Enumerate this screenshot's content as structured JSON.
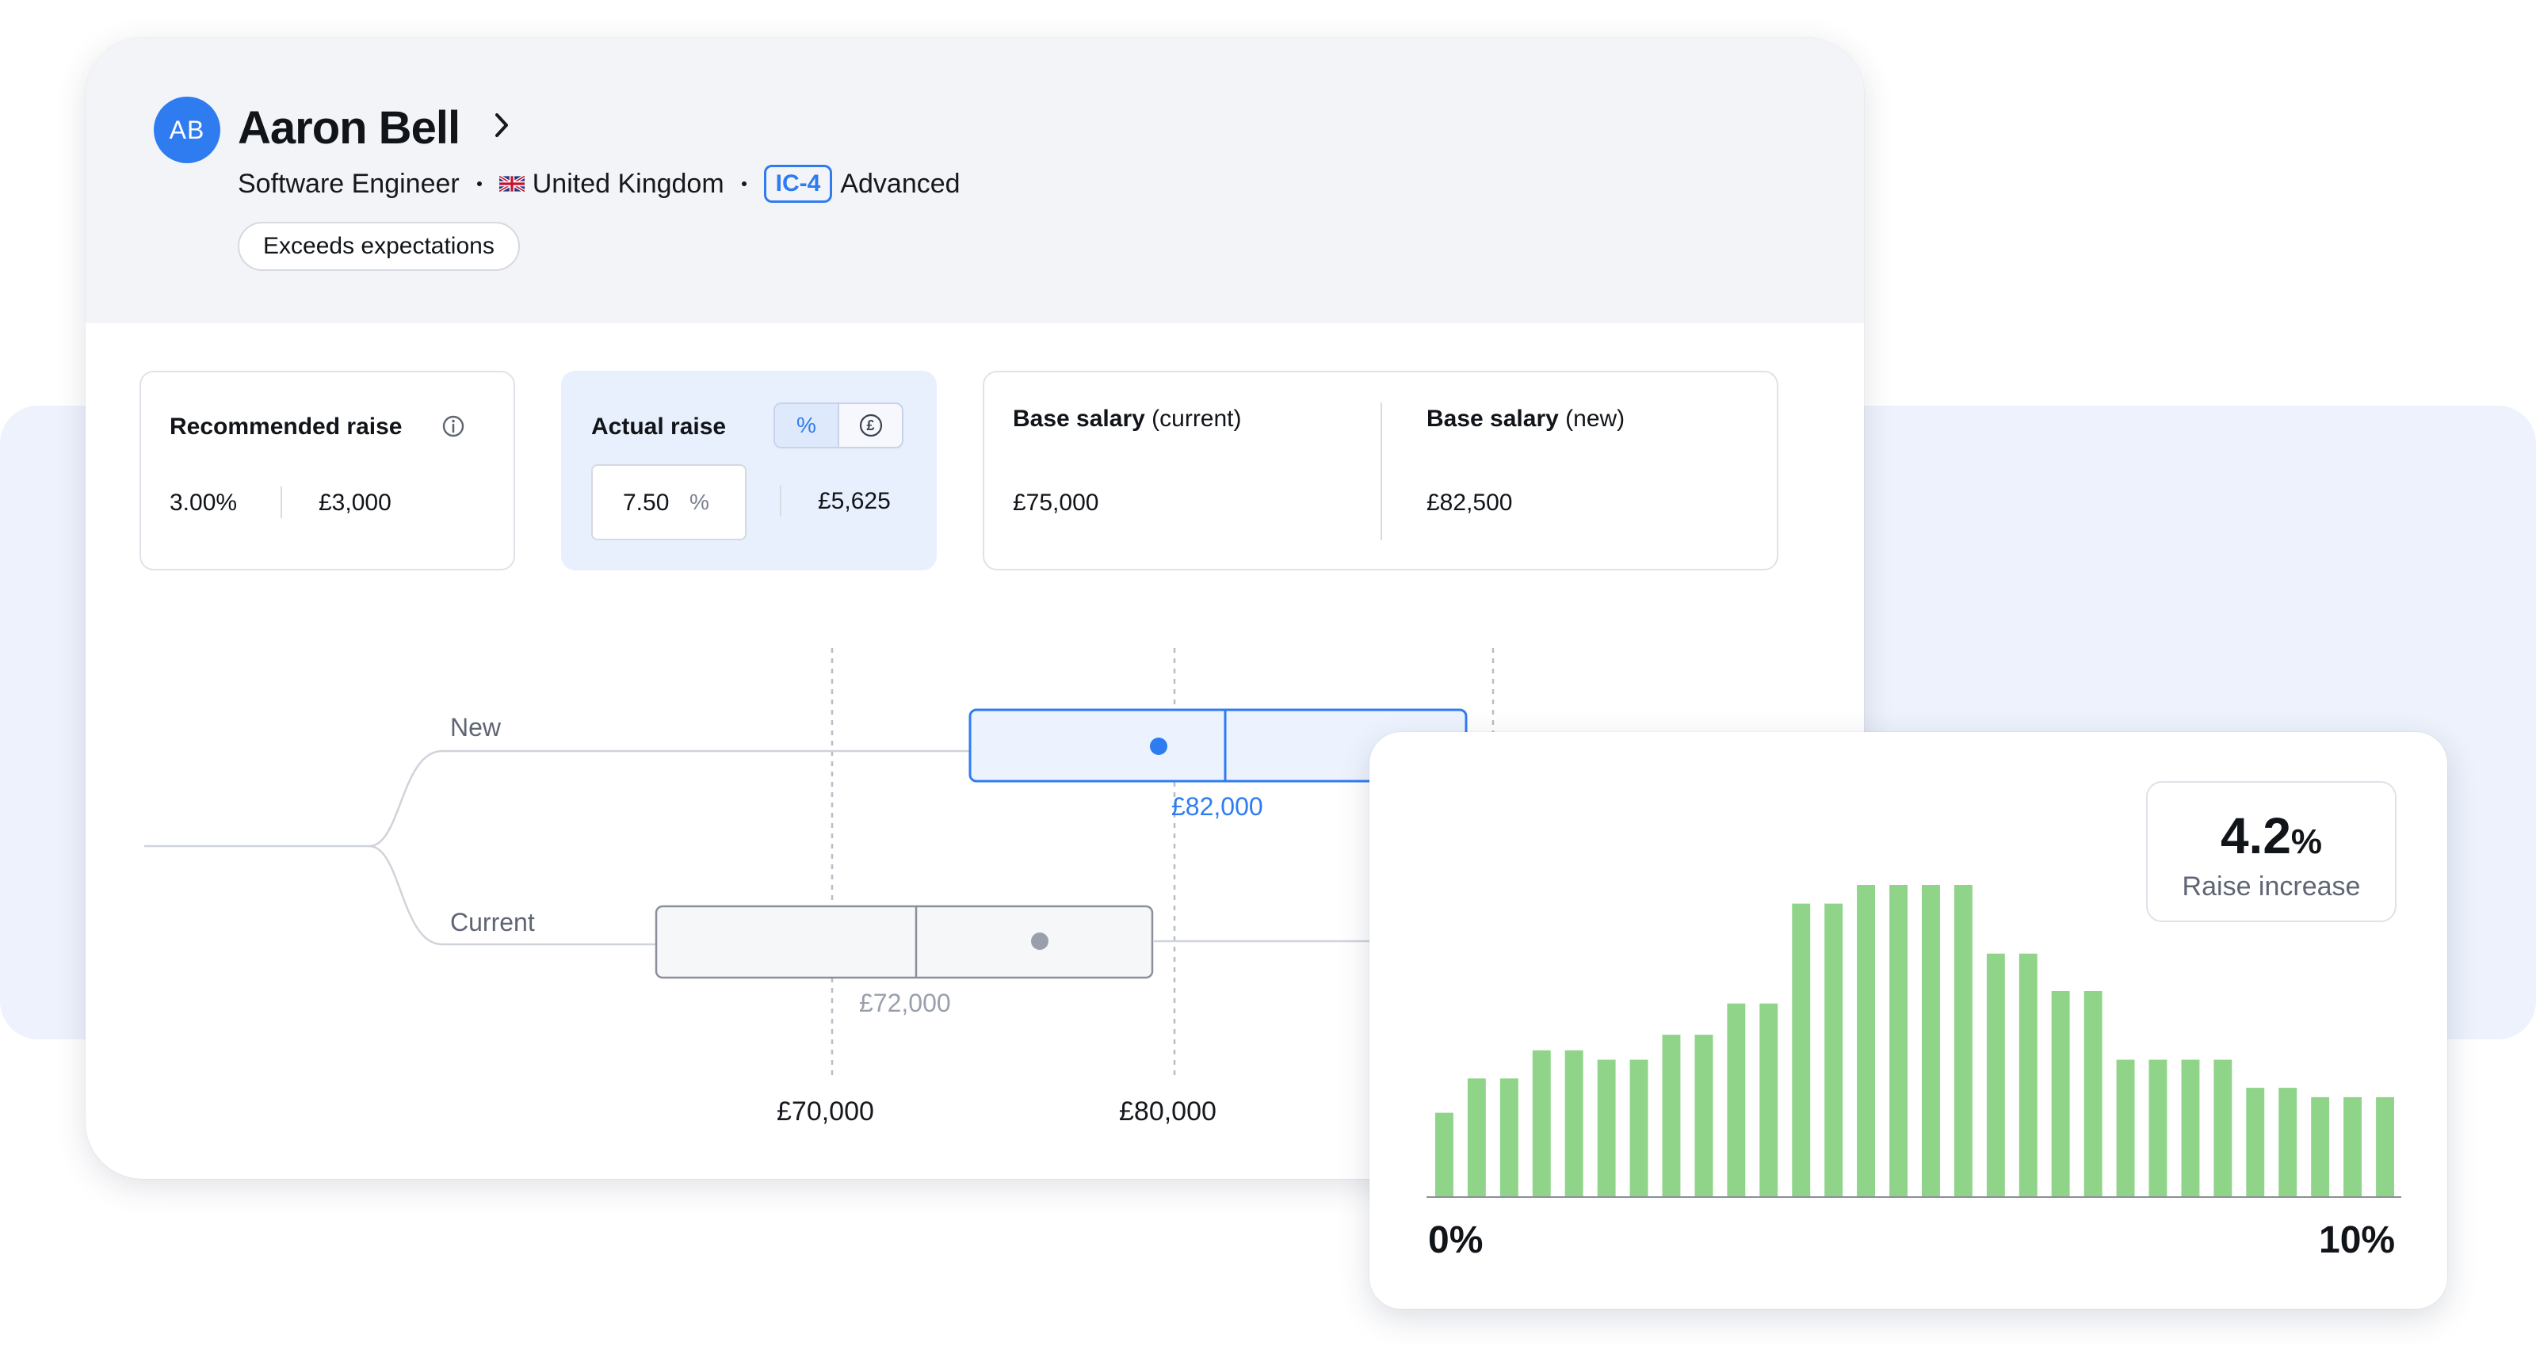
{
  "employee": {
    "initials": "AB",
    "name": "Aaron Bell",
    "role": "Software Engineer",
    "country": "United Kingdom",
    "level_code": "IC-4",
    "level_name": "Advanced",
    "performance": "Exceeds expectations"
  },
  "recommended_raise": {
    "label": "Recommended raise",
    "percent": "3.00%",
    "amount": "£3,000"
  },
  "actual_raise": {
    "label": "Actual raise",
    "toggle_percent": "%",
    "toggle_currency": "£",
    "input_value": "7.50",
    "input_unit": "%",
    "amount": "£5,625"
  },
  "base_salary": {
    "current_label": "Base salary",
    "current_qualifier": "(current)",
    "current_value": "£75,000",
    "new_label": "Base salary",
    "new_qualifier": "(new)",
    "new_value": "£82,500"
  },
  "range_chart": {
    "axis_labels": [
      "£70,000",
      "£80,000"
    ],
    "rows": {
      "new": {
        "label": "New",
        "median_label": "£82,000"
      },
      "current": {
        "label": "Current",
        "median_label": "£72,000"
      }
    }
  },
  "colors": {
    "accent": "#2f7cf0",
    "bar": "#8fd488"
  },
  "histogram": {
    "kpi_value": "4.2",
    "kpi_unit": "%",
    "kpi_label": "Raise increase",
    "x_min_label": "0%",
    "x_max_label": "10%"
  },
  "chart_data": {
    "type": "bar",
    "x_range": [
      0,
      10
    ],
    "values": [
      27,
      38,
      38,
      47,
      47,
      44,
      44,
      52,
      52,
      62,
      62,
      94,
      94,
      100,
      100,
      100,
      100,
      78,
      78,
      66,
      66,
      44,
      44,
      44,
      44,
      35,
      35,
      32,
      32,
      32
    ]
  }
}
